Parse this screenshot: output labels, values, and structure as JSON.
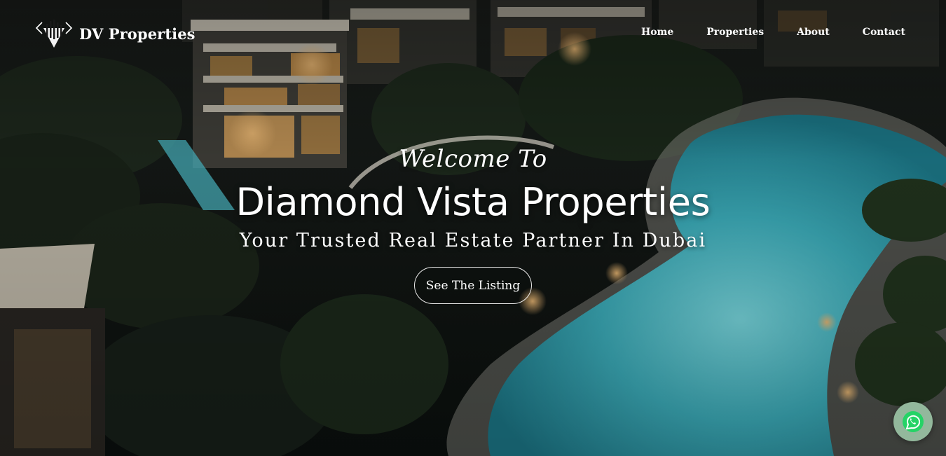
{
  "brand": {
    "name": "DV Properties",
    "logo_icon": "diamond-skyline-logo-icon"
  },
  "nav": {
    "items": [
      {
        "label": "Home"
      },
      {
        "label": "Properties"
      },
      {
        "label": "About"
      },
      {
        "label": "Contact"
      }
    ]
  },
  "hero": {
    "welcome": "Welcome To",
    "title": "Diamond Vista Properties",
    "tagline": "Your Trusted Real Estate Partner In Dubai",
    "cta_label": "See The Listing",
    "background_icon": "luxury-villas-pool-night-image"
  },
  "whatsapp": {
    "icon": "whatsapp-icon",
    "color": "#25d366"
  },
  "colors": {
    "text": "#ffffff",
    "pool": "#4fc3d0",
    "whatsapp_bg": "#93b89c"
  }
}
